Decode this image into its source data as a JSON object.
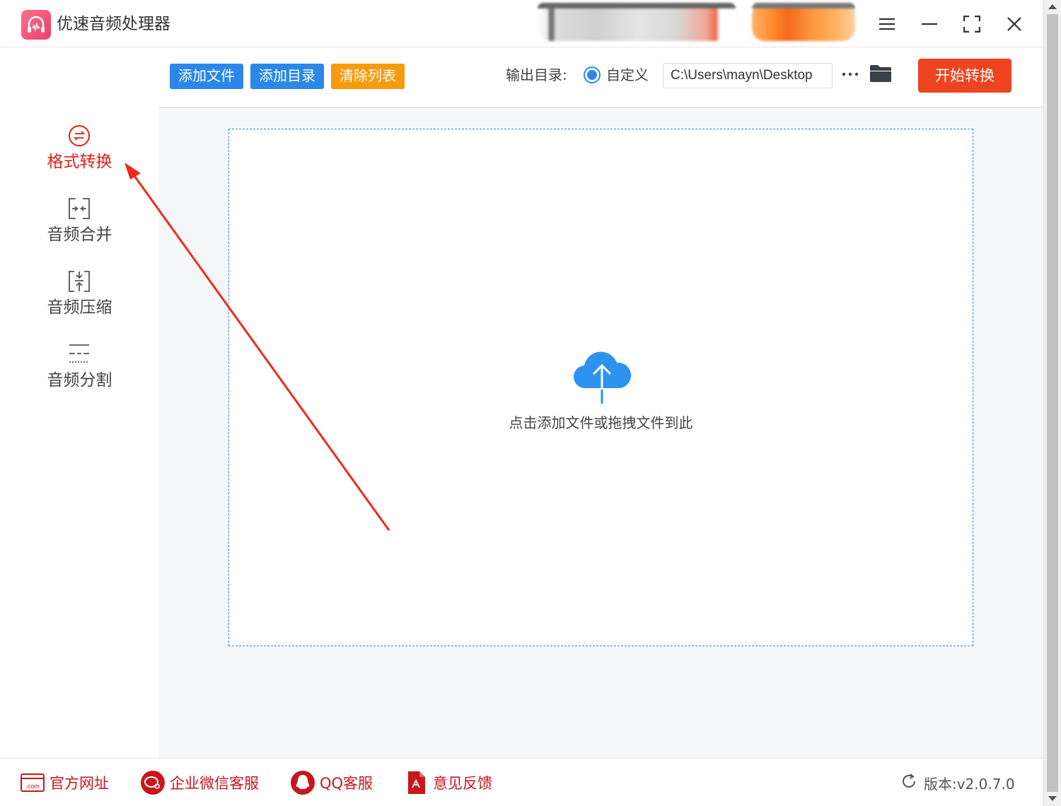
{
  "app": {
    "title": "优速音频处理器",
    "accent_color": "#2b88e8",
    "active_color": "#e0201b"
  },
  "window_controls": [
    "menu-icon",
    "minimize-icon",
    "fullscreen-icon",
    "close-icon"
  ],
  "sidebar": {
    "items": [
      {
        "label": "格式转换",
        "icon": "convert-icon",
        "active": true
      },
      {
        "label": "音频合并",
        "icon": "merge-icon",
        "active": false
      },
      {
        "label": "音频压缩",
        "icon": "compress-icon",
        "active": false
      },
      {
        "label": "音频分割",
        "icon": "split-icon",
        "active": false
      }
    ]
  },
  "toolbar": {
    "add_file": "添加文件",
    "add_folder": "添加目录",
    "clear_list": "清除列表",
    "output_label": "输出目录:",
    "custom_radio": "自定义",
    "output_path": "C:\\Users\\mayn\\Desktop",
    "more": "···",
    "start": "开始转换"
  },
  "dropzone": {
    "text": "点击添加文件或拖拽文件到此"
  },
  "footer": {
    "website": "官方网址",
    "wechat": "企业微信客服",
    "qq": "QQ客服",
    "feedback": "意见反馈",
    "version": "版本:v2.0.7.0"
  }
}
